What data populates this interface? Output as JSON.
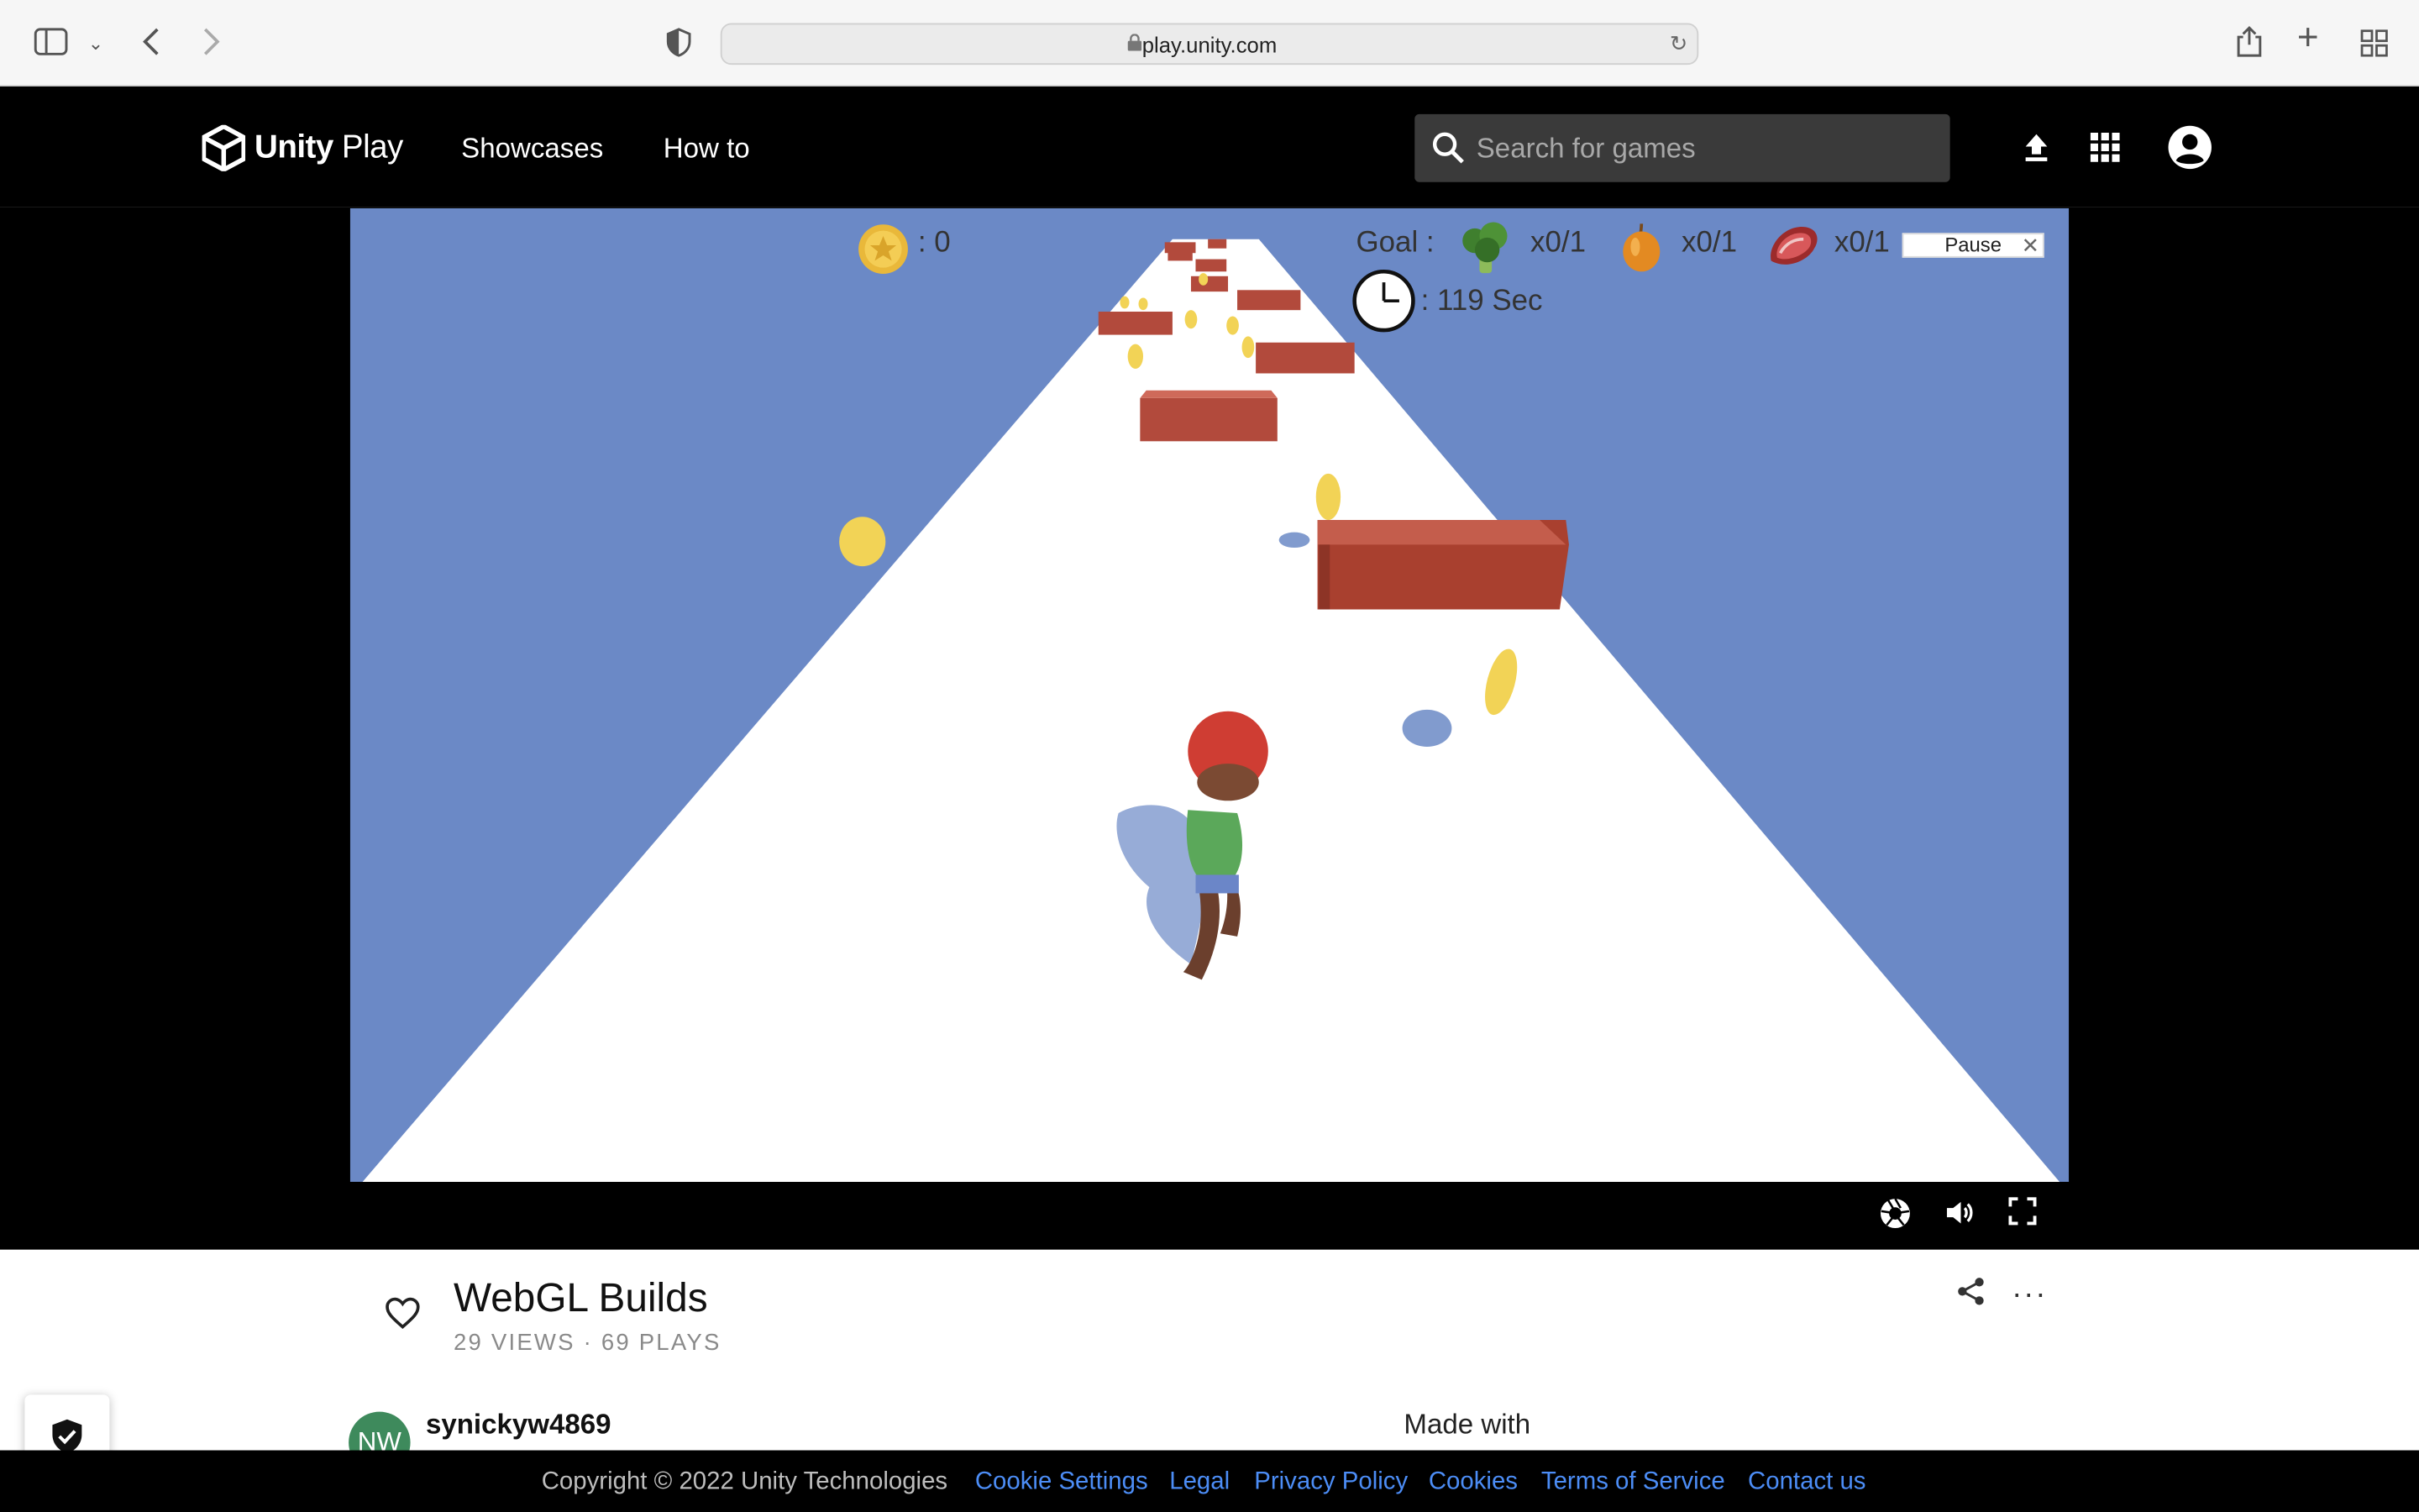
{
  "browser": {
    "url": "play.unity.com"
  },
  "header": {
    "logo_bold": "Unity",
    "logo_light": " Play",
    "nav": [
      "Showcases",
      "How to"
    ],
    "search_placeholder": "Search for games"
  },
  "game": {
    "coin_count": ": 0",
    "goal_label": "Goal :",
    "goals": [
      {
        "icon": "broccoli-icon",
        "text": "x0/1"
      },
      {
        "icon": "onion-icon",
        "text": "x0/1"
      },
      {
        "icon": "meat-icon",
        "text": "x0/1"
      }
    ],
    "timer": ": 119 Sec",
    "pause_label": "Pause",
    "colors": {
      "sky": "#6b89c6",
      "road": "#ffffff",
      "block": "#b24a3c",
      "coin": "#f2d356"
    }
  },
  "player_controls": [
    "screenshot-icon",
    "volume-icon",
    "fullscreen-icon"
  ],
  "project": {
    "title": "WebGL Builds",
    "meta": "29 VIEWS · 69 PLAYS",
    "avatar_initials": "NW",
    "username": "synickyw4869",
    "made_with": "Made with"
  },
  "footer": {
    "copyright": "Copyright © 2022 Unity Technologies",
    "links": [
      "Cookie Settings",
      "Legal",
      "Privacy Policy",
      "Cookies",
      "Terms of Service",
      "Contact us"
    ],
    "link_color": "#4c8df6"
  }
}
